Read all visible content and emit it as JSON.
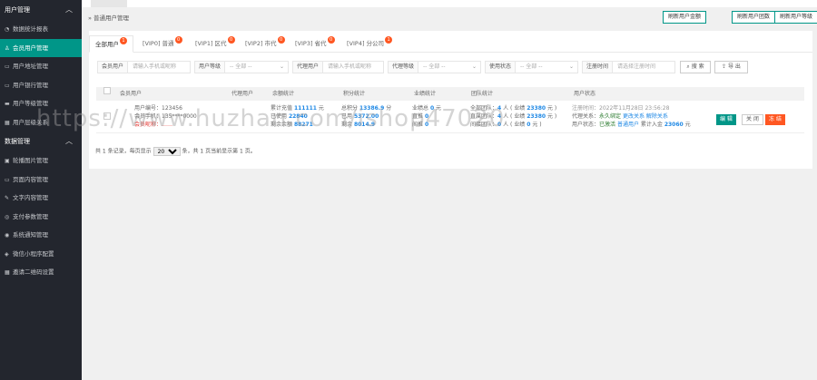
{
  "sidebar": {
    "sections": [
      {
        "title": "用户管理",
        "items": [
          {
            "label": "数据统计报表",
            "icon": "chart-icon",
            "active": false
          },
          {
            "label": "会员用户管理",
            "icon": "user-icon",
            "active": true
          },
          {
            "label": "用户地址管理",
            "icon": "address-icon",
            "active": false
          },
          {
            "label": "用户银行管理",
            "icon": "bank-icon",
            "active": false
          },
          {
            "label": "用户等级管理",
            "icon": "level-icon",
            "active": false
          },
          {
            "label": "用户层级关系",
            "icon": "tree-icon",
            "active": false
          }
        ]
      },
      {
        "title": "数据管理",
        "items": [
          {
            "label": "轮播图片管理",
            "icon": "image-icon",
            "active": false
          },
          {
            "label": "页面内容管理",
            "icon": "page-icon",
            "active": false
          },
          {
            "label": "文字内容管理",
            "icon": "text-icon",
            "active": false
          },
          {
            "label": "支付参数管理",
            "icon": "pay-icon",
            "active": false
          },
          {
            "label": "系统通知管理",
            "icon": "bell-icon",
            "active": false
          },
          {
            "label": "微信小程序配置",
            "icon": "wechat-icon",
            "active": false
          },
          {
            "label": "邀请二维码设置",
            "icon": "qrcode-icon",
            "active": false
          }
        ]
      }
    ]
  },
  "header": {
    "breadcrumb": "普通用户管理",
    "buttons": [
      "刷新用户金额",
      "刷新用户团数",
      "刷新用户等级"
    ]
  },
  "tabs": [
    {
      "label": "全部用户",
      "badge": "1"
    },
    {
      "label": "[VIP0] 普通",
      "badge": "0"
    },
    {
      "label": "[VIP1] 区代",
      "badge": "0"
    },
    {
      "label": "[VIP2] 市代",
      "badge": "0"
    },
    {
      "label": "[VIP3] 省代",
      "badge": "0"
    },
    {
      "label": "[VIP4] 分公司",
      "badge": "1"
    }
  ],
  "filters": [
    {
      "label": "会员用户",
      "placeholder": "请输入手机或昵称",
      "type": "input"
    },
    {
      "label": "用户等级",
      "placeholder": "-- 全部 --",
      "type": "select"
    },
    {
      "label": "代理用户",
      "placeholder": "请输入手机或昵称",
      "type": "input"
    },
    {
      "label": "代理等级",
      "placeholder": "-- 全部 --",
      "type": "select"
    },
    {
      "label": "使用状态",
      "placeholder": "-- 全部 --",
      "type": "select"
    },
    {
      "label": "注册时间",
      "placeholder": "请选择注册时间",
      "type": "input"
    }
  ],
  "filter_buttons": {
    "search": "搜 索",
    "export": "导 出"
  },
  "table": {
    "headers": [
      "会员用户",
      "代理用户",
      "余额统计",
      "积分统计",
      "业绩统计",
      "团队统计",
      "用户状态"
    ],
    "row": {
      "member": [
        "用户编号：123456",
        "会员手机：135****0000",
        "会员昵称：……"
      ],
      "balance": {
        "l1": "累计充值",
        "v1": "111111",
        "u1": "元",
        "l2": "已使用",
        "v2": "22840",
        "l3": "剩余余额",
        "v3": "88271"
      },
      "points": {
        "l1": "总积分",
        "v1": "13386.9",
        "u1": "分",
        "l2": "已用",
        "v2": "5372.00",
        "l3": "剩余",
        "v3": "8014.9"
      },
      "perf": {
        "l1": "业绩总",
        "v1": "0",
        "u1": "元",
        "l2": "直推",
        "v2": "0",
        "l3": "间推",
        "v3": "0"
      },
      "team": {
        "l1": "全部团队：",
        "c1": "4",
        "t1": "人 ( 业绩",
        "a1": "23380",
        "u1": "元 )",
        "l2": "直属团队：",
        "c2": "4",
        "t2": "人 ( 业绩",
        "a2": "23380",
        "u2": "元 )",
        "l3": "间接团队：",
        "c3": "0",
        "t3": "人 ( 业绩",
        "a3": "0",
        "u3": "元 )"
      },
      "status": {
        "reg": "注册时间：2022年11月28日 23:56:28",
        "agent_label": "代理关系：",
        "agent_v1": "永久绑定",
        "agent_v2": "更改关系",
        "agent_v3": "解除关系",
        "state_label": "用户状态：",
        "state_v1": "已激活",
        "state_v2": "普通用户",
        "state_v3": "累计入金",
        "state_amount": "23060",
        "state_unit": "元"
      },
      "actions": [
        "编 辑",
        "关 闭",
        "冻 结"
      ]
    }
  },
  "pager": {
    "prefix": "共 1 条记录，每页显示",
    "per_page": "20",
    "suffix": "条，共 1 页当前显示第 1 页。"
  },
  "watermark": "https://www.huzhan.com/ishop47020",
  "colors": {
    "sidebar_bg": "#23262e",
    "accent": "#009688",
    "danger": "#ff5722",
    "badge": "#ff5722"
  }
}
